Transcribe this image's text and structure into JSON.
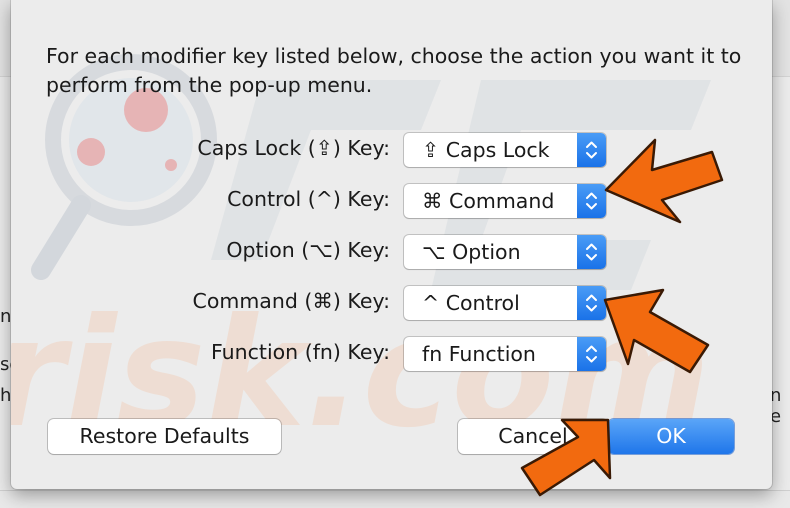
{
  "background": {
    "fragments": [
      "nc",
      "se",
      "h",
      "n e"
    ]
  },
  "dialog": {
    "intro": "For each modifier key listed below, choose the action you want it to perform from the pop-up menu.",
    "rows": [
      {
        "label": "Caps Lock (⇪) Key:",
        "value": "⇪ Caps Lock"
      },
      {
        "label": "Control (^) Key:",
        "value": "⌘ Command"
      },
      {
        "label": "Option (⌥) Key:",
        "value": "⌥ Option"
      },
      {
        "label": "Command (⌘) Key:",
        "value": "^ Control"
      },
      {
        "label": "Function (fn) Key:",
        "value": "fn Function"
      }
    ],
    "buttons": {
      "restore_defaults": "Restore Defaults",
      "cancel": "Cancel",
      "ok": "OK"
    }
  },
  "watermark": {
    "text": "risk.com"
  },
  "colors": {
    "accent_blue": "#1f76ea",
    "arrow_orange": "#f26a0f"
  },
  "icons": [
    "up-down-chevron-icon",
    "pointer-arrow-icon"
  ]
}
